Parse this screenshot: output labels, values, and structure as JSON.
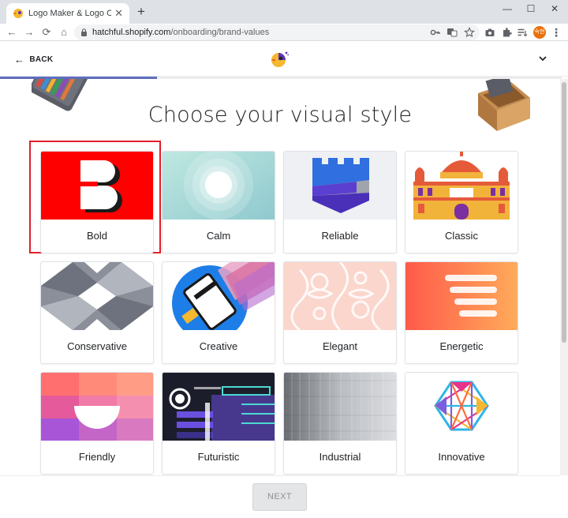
{
  "browser": {
    "tab_title": "Logo Maker & Logo Creator - F",
    "tab_close": "✕",
    "new_tab": "+",
    "url_domain": "hatchful.shopify.com",
    "url_path": "/onboarding/brand-values",
    "profile_initials": "숙현",
    "window_controls": {
      "minimize": "—",
      "maximize": "☐",
      "close": "✕"
    },
    "nav": {
      "back": "←",
      "forward": "→",
      "reload": "⟳",
      "home": "⌂"
    },
    "menu": "⋮"
  },
  "header": {
    "back_label": "BACK",
    "progress": 0.28
  },
  "main": {
    "heading": "Choose your visual style",
    "selected_style": "Bold",
    "styles": [
      {
        "label": "Bold"
      },
      {
        "label": "Calm"
      },
      {
        "label": "Reliable"
      },
      {
        "label": "Classic"
      },
      {
        "label": "Conservative"
      },
      {
        "label": "Creative"
      },
      {
        "label": "Elegant"
      },
      {
        "label": "Energetic"
      },
      {
        "label": "Friendly"
      },
      {
        "label": "Futuristic"
      },
      {
        "label": "Industrial"
      },
      {
        "label": "Innovative"
      }
    ]
  },
  "footer": {
    "next_label": "NEXT"
  },
  "colors": {
    "accent": "#5e6ebf",
    "selection": "#e0202a",
    "bold_red": "#ff0000"
  }
}
